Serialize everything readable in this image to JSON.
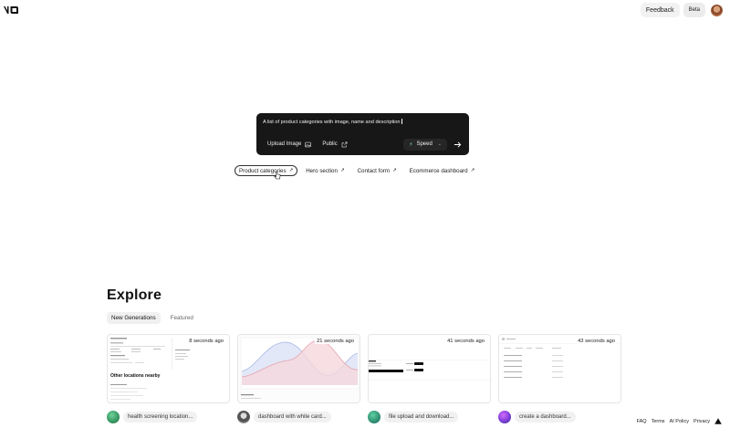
{
  "header": {
    "logo_name": "v0",
    "feedback_label": "Feedback",
    "beta_label": "Beta"
  },
  "prompt": {
    "text": "A list of product categories with image, name and description",
    "upload_label": "Upload Image",
    "visibility_label": "Public",
    "mode_label": "Speed"
  },
  "suggestions": [
    {
      "label": "Product categories"
    },
    {
      "label": "Hero section"
    },
    {
      "label": "Contact form"
    },
    {
      "label": "Ecommerce dashboard"
    }
  ],
  "explore": {
    "title": "Explore",
    "tabs": [
      {
        "label": "New Generations"
      },
      {
        "label": "Featured"
      }
    ],
    "cards": [
      {
        "time": "8 seconds ago",
        "label": "health screening location...",
        "avatar_color": "#3aa36b"
      },
      {
        "time": "21 seconds ago",
        "label": "dashboard with white card...",
        "avatar_color": "#555555"
      },
      {
        "time": "41 seconds ago",
        "label": "file upload and download...",
        "avatar_color": "#2f8f6f"
      },
      {
        "time": "43 seconds ago",
        "label": "create a dashboard...",
        "avatar_color": "#7b3fd6"
      }
    ]
  },
  "thumb_text": {
    "other_locations": "Other locations nearby"
  },
  "footer": {
    "faq": "FAQ",
    "terms": "Terms",
    "ai_policy": "AI Policy",
    "privacy": "Privacy"
  },
  "colors": {
    "prompt_bg": "#171717",
    "accent_green": "#7ee2a8"
  }
}
